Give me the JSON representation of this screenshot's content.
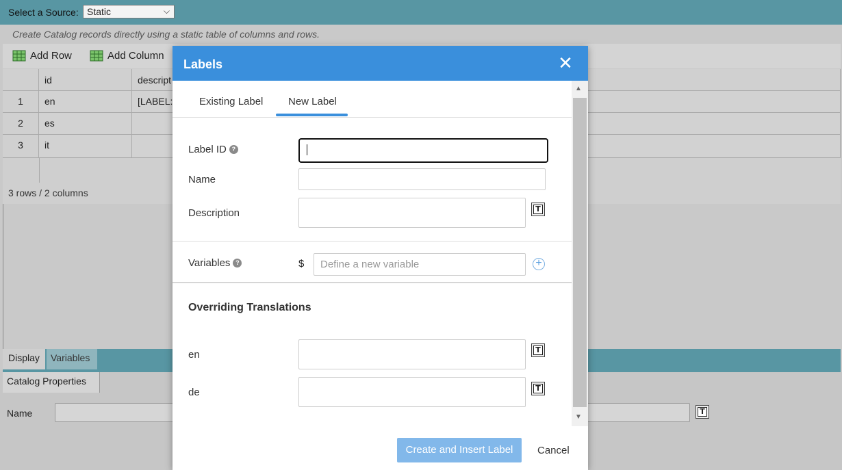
{
  "source": {
    "label": "Select a Source:",
    "selected": "Static"
  },
  "description": "Create Catalog records directly using a static table of columns and rows.",
  "toolbar": {
    "add_row": "Add Row",
    "add_column": "Add Column"
  },
  "grid": {
    "headers": [
      "id",
      "descript"
    ],
    "rows": [
      {
        "num": "1",
        "id": "en",
        "desc": "[LABEL:"
      },
      {
        "num": "2",
        "id": "es",
        "desc": ""
      },
      {
        "num": "3",
        "id": "it",
        "desc": ""
      }
    ],
    "status": "3 rows / 2 columns"
  },
  "bottom_tabs": {
    "display": "Display",
    "variables": "Variables"
  },
  "properties": {
    "tab": "Catalog Properties",
    "name_label": "Name"
  },
  "modal": {
    "title": "Labels",
    "tabs": {
      "existing": "Existing Label",
      "new": "New Label"
    },
    "fields": {
      "label_id": "Label ID",
      "name": "Name",
      "description": "Description",
      "variables": "Variables",
      "variables_prefix": "$",
      "variables_placeholder": "Define a new variable"
    },
    "section_title": "Overriding Translations",
    "translations": [
      "en",
      "de"
    ],
    "buttons": {
      "create": "Create and Insert Label",
      "cancel": "Cancel"
    }
  },
  "colors": {
    "accent": "#3a8fdc",
    "topbar": "#5896a3",
    "button_disabled": "#82b8ea"
  }
}
